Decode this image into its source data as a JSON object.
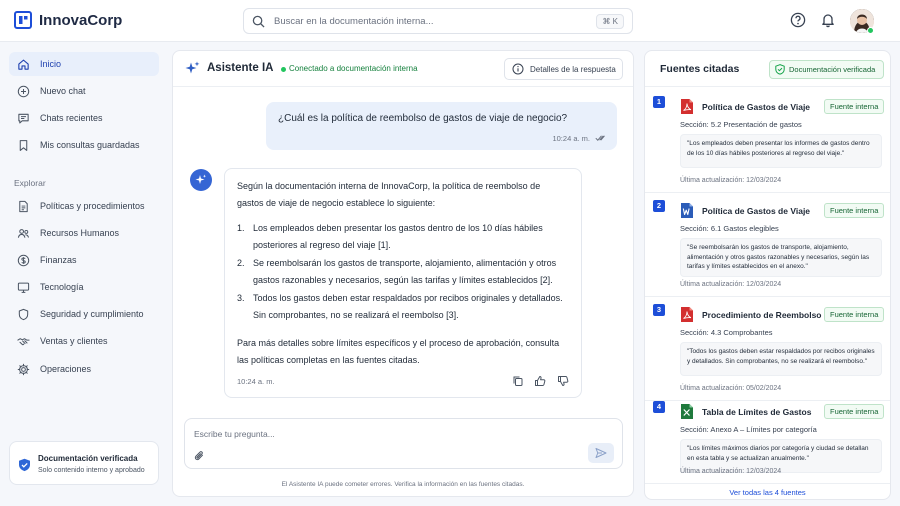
{
  "app": {
    "name": "InnovaCorp"
  },
  "search": {
    "placeholder": "Buscar en la documentación interna...",
    "shortcut": "⌘ K"
  },
  "header_icons": [
    "help-icon",
    "bell-icon",
    "user-avatar"
  ],
  "sidebar": {
    "items": [
      {
        "label": "Inicio",
        "icon": "home-icon",
        "active": true
      },
      {
        "label": "Nuevo chat",
        "icon": "plus-circle-icon"
      },
      {
        "label": "Chats recientes",
        "icon": "chat-icon"
      },
      {
        "label": "Mis consultas guardadas",
        "icon": "bookmark-icon"
      }
    ],
    "explore_title": "Explorar",
    "explore": [
      {
        "label": "Políticas y procedimientos",
        "icon": "document-icon"
      },
      {
        "label": "Recursos Humanos",
        "icon": "people-icon"
      },
      {
        "label": "Finanzas",
        "icon": "dollar-icon"
      },
      {
        "label": "Tecnología",
        "icon": "monitor-icon"
      },
      {
        "label": "Seguridad y cumplimiento",
        "icon": "shield-icon"
      },
      {
        "label": "Ventas y clientes",
        "icon": "handshake-icon"
      },
      {
        "label": "Operaciones",
        "icon": "gear-icon"
      }
    ],
    "verified": {
      "title": "Documentación verificada",
      "subtitle": "Solo contenido interno y aprobado"
    }
  },
  "chat": {
    "title": "Asistente IA",
    "status": "Conectado a documentación interna",
    "details_button": "Detalles de la respuesta",
    "user_message": {
      "text": "¿Cuál es la política de reembolso de gastos de viaje de negocio?",
      "time": "10:24 a. m."
    },
    "assistant": {
      "intro": "Según la documentación interna de InnovaCorp, la política de reembolso de gastos de viaje de negocio establece lo siguiente:",
      "points": [
        {
          "num": "1.",
          "text": "Los empleados deben presentar los gastos dentro de los 10 días hábiles posteriores al regreso del viaje [1]."
        },
        {
          "num": "2.",
          "text": "Se reembolsarán los gastos de transporte, alojamiento, alimentación y otros gastos razonables y necesarios, según las tarifas y límites establecidos [2]."
        },
        {
          "num": "3.",
          "text": "Todos los gastos deben estar respaldados por recibos originales y detallados. Sin comprobantes, no se realizará el reembolso [3]."
        }
      ],
      "outro": "Para más detalles sobre límites específicos y el proceso de aprobación, consulta las políticas completas en las fuentes citadas.",
      "time": "10:24 a. m."
    },
    "composer_placeholder": "Escribe tu pregunta...",
    "disclaimer": "El Asistente IA puede cometer errores. Verifica la información en las fuentes citadas."
  },
  "sources": {
    "title": "Fuentes citadas",
    "badge": "Documentación verificada",
    "items": [
      {
        "num": "1",
        "type": "pdf",
        "name": "Política de Gastos de Viaje",
        "tag": "Fuente interna",
        "section": "Sección: 5.2 Presentación de gastos",
        "quote": "\"Los empleados deben presentar los informes de gastos dentro de los 10 días hábiles posteriores al regreso del viaje.\"",
        "updated": "Última actualización: 12/03/2024"
      },
      {
        "num": "2",
        "type": "word",
        "name": "Política de Gastos de Viaje",
        "tag": "Fuente interna",
        "section": "Sección: 6.1 Gastos elegibles",
        "quote": "\"Se reembolsarán los gastos de transporte, alojamiento, alimentación y otros gastos razonables y necesarios, según las tarifas y límites establecidos en el anexo.\"",
        "updated": "Última actualización: 12/03/2024"
      },
      {
        "num": "3",
        "type": "pdf",
        "name": "Procedimiento de Reembolso",
        "tag": "Fuente interna",
        "section": "Sección: 4.3 Comprobantes",
        "quote": "\"Todos los gastos deben estar respaldados por recibos originales y detallados. Sin comprobantes, no se realizará el reembolso.\"",
        "updated": "Última actualización: 05/02/2024"
      },
      {
        "num": "4",
        "type": "excel",
        "name": "Tabla de Límites de Gastos",
        "tag": "Fuente interna",
        "section": "Sección: Anexo A – Límites por categoría",
        "quote": "\"Los límites máximos diarios por categoría y ciudad se detallan en esta tabla y se actualizan anualmente.\"",
        "updated": "Última actualización: 12/03/2024"
      }
    ],
    "see_all": "Ver todas las 4 fuentes"
  },
  "colors": {
    "accent": "#1d4ed8",
    "active_bg": "#e8effb",
    "user_bubble": "#e9f0fb",
    "verified_green": "#16a34a",
    "pdf_red": "#d32f2f",
    "word_blue": "#2b5cb8",
    "excel_green": "#1f7a3d"
  }
}
